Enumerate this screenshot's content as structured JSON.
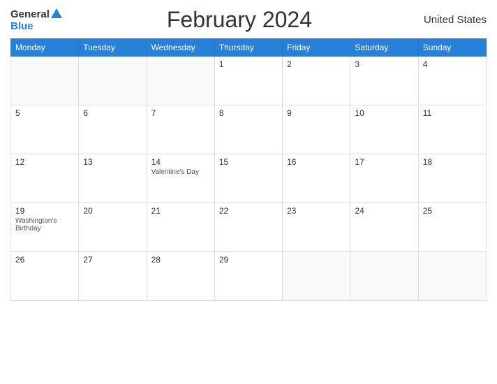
{
  "header": {
    "logo_general": "General",
    "logo_blue": "Blue",
    "title": "February 2024",
    "country": "United States"
  },
  "calendar": {
    "days_of_week": [
      "Monday",
      "Tuesday",
      "Wednesday",
      "Thursday",
      "Friday",
      "Saturday",
      "Sunday"
    ],
    "weeks": [
      [
        {
          "num": "",
          "empty": true
        },
        {
          "num": "",
          "empty": true
        },
        {
          "num": "",
          "empty": true
        },
        {
          "num": "1",
          "holiday": ""
        },
        {
          "num": "2",
          "holiday": ""
        },
        {
          "num": "3",
          "holiday": ""
        },
        {
          "num": "4",
          "holiday": ""
        }
      ],
      [
        {
          "num": "5",
          "holiday": ""
        },
        {
          "num": "6",
          "holiday": ""
        },
        {
          "num": "7",
          "holiday": ""
        },
        {
          "num": "8",
          "holiday": ""
        },
        {
          "num": "9",
          "holiday": ""
        },
        {
          "num": "10",
          "holiday": ""
        },
        {
          "num": "11",
          "holiday": ""
        }
      ],
      [
        {
          "num": "12",
          "holiday": ""
        },
        {
          "num": "13",
          "holiday": ""
        },
        {
          "num": "14",
          "holiday": "Valentine's Day"
        },
        {
          "num": "15",
          "holiday": ""
        },
        {
          "num": "16",
          "holiday": ""
        },
        {
          "num": "17",
          "holiday": ""
        },
        {
          "num": "18",
          "holiday": ""
        }
      ],
      [
        {
          "num": "19",
          "holiday": "Washington's Birthday"
        },
        {
          "num": "20",
          "holiday": ""
        },
        {
          "num": "21",
          "holiday": ""
        },
        {
          "num": "22",
          "holiday": ""
        },
        {
          "num": "23",
          "holiday": ""
        },
        {
          "num": "24",
          "holiday": ""
        },
        {
          "num": "25",
          "holiday": ""
        }
      ],
      [
        {
          "num": "26",
          "holiday": ""
        },
        {
          "num": "27",
          "holiday": ""
        },
        {
          "num": "28",
          "holiday": ""
        },
        {
          "num": "29",
          "holiday": ""
        },
        {
          "num": "",
          "empty": true
        },
        {
          "num": "",
          "empty": true
        },
        {
          "num": "",
          "empty": true
        }
      ]
    ]
  }
}
